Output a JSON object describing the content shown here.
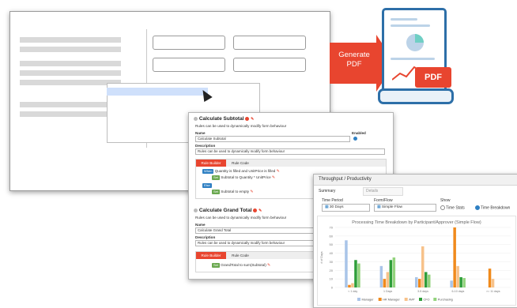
{
  "arrow": {
    "label": "Generate PDF"
  },
  "pdf": {
    "badge": "PDF"
  },
  "rules": {
    "subtotal": {
      "title": "Calculate Subtotal",
      "subtitle": "Rules can be used to dynamically modify form behaviour",
      "name_label": "Name",
      "name_value": "Calculate Subtotal",
      "enabled_label": "Enabled",
      "desc_label": "Description",
      "desc_value": "Rules can be used to dynamically modify form behaviour",
      "tabs": [
        "Rule Builder",
        "Rule Code"
      ],
      "when_tag": "When",
      "when_text": "Quantity is filled and UnitPrice is filled",
      "set_tag": "Set",
      "set_text": "Subtotal to Quantity * UnitPrice",
      "else_tag": "Else",
      "else_set_text": "Subtotal to empty"
    },
    "grand": {
      "title": "Calculate Grand Total",
      "subtitle": "Rules can be used to dynamically modify form behaviour",
      "name_label": "Name",
      "name_value": "Calculate Grand Total",
      "desc_label": "Description",
      "desc_value": "Rules can be used to dynamically modify form behaviour",
      "tabs": [
        "Rule Builder",
        "Rule Code"
      ],
      "set_tag": "Set",
      "set_text": "GrandTotal to sum(Subtotal)"
    }
  },
  "throughput": {
    "header": "Throughput / Productivity",
    "tabs": [
      "Summary",
      "Details"
    ],
    "time_period_label": "Time Period",
    "time_period_value": "30 Days",
    "form_flow_label": "Form/Flow",
    "form_flow_value": "Simple Flow",
    "show_label": "Show",
    "show_options": [
      "Time Stats",
      "Time Breakdown"
    ],
    "show_selected": "Time Breakdown"
  },
  "chart_data": {
    "type": "bar",
    "title": "Processing Time Breakdown by Participant/Approver (Simple Flow)",
    "ylabel": "# of Days",
    "ylim": [
      0,
      70
    ],
    "yticks": [
      0,
      10,
      20,
      30,
      40,
      50,
      60,
      70
    ],
    "categories": [
      "< 1 day",
      "1 Days",
      "3-5 days",
      "6-10 days",
      ">= 11 days"
    ],
    "series": [
      {
        "name": "Manager",
        "color": "#a9c4e8",
        "values": [
          55,
          25,
          12,
          8,
          0
        ]
      },
      {
        "name": "HR Manager",
        "color": "#f08a1c",
        "values": [
          3,
          10,
          10,
          70,
          22
        ]
      },
      {
        "name": "AVP",
        "color": "#f7c28a",
        "values": [
          5,
          18,
          48,
          25,
          10
        ]
      },
      {
        "name": "CFO",
        "color": "#2f9e3a",
        "values": [
          32,
          32,
          18,
          12,
          0
        ]
      },
      {
        "name": "Purchasing",
        "color": "#93d37d",
        "values": [
          28,
          35,
          15,
          11,
          0
        ]
      }
    ]
  }
}
